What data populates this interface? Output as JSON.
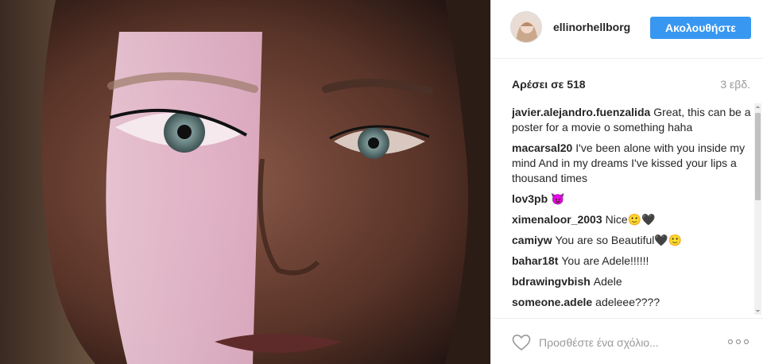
{
  "post": {
    "username": "ellinorhellborg",
    "follow_label": "Ακολουθήστε",
    "likes_text": "Αρέσει σε 518",
    "time_ago": "3 εβδ."
  },
  "comments": [
    {
      "user": "javier.alejandro.fuenzalida",
      "text": "Great, this can be a poster for a movie o something haha"
    },
    {
      "user": "macarsal20",
      "text": "I've been alone with you inside my mind And in my dreams I've kissed your lips a thousand times"
    },
    {
      "user": "lov3pb",
      "text": "😈"
    },
    {
      "user": "ximenaloor_2003",
      "text": "Nice🙂🖤"
    },
    {
      "user": "camiyw",
      "text": "You are so Beautiful🖤🙂"
    },
    {
      "user": "bahar18t",
      "text": "You are Adele!!!!!!"
    },
    {
      "user": "bdrawingvbish",
      "text": "Adele"
    },
    {
      "user": "someone.adele",
      "text": "adeleee????"
    }
  ],
  "add_comment": {
    "placeholder": "Προσθέστε ένα σχόλιο..."
  },
  "icons": {
    "like": "heart-outline-icon",
    "more": "more-options-icon"
  },
  "colors": {
    "accent": "#3897f0",
    "text": "#262626",
    "muted": "#999999"
  }
}
